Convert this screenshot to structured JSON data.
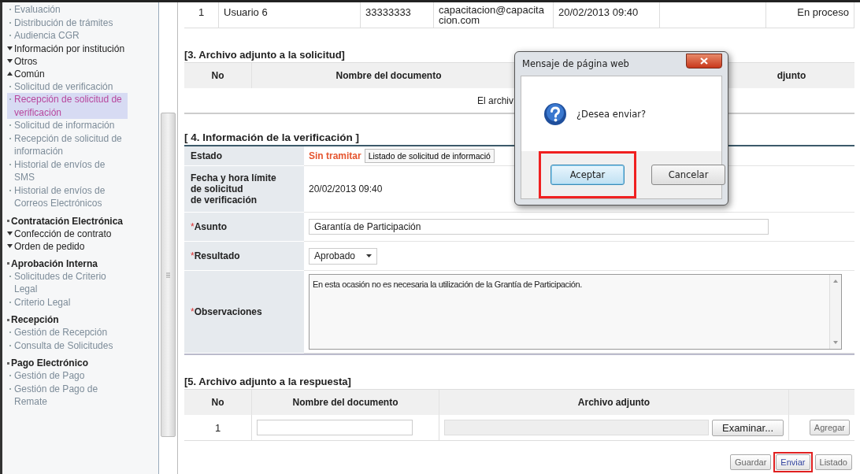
{
  "sidebar": {
    "items": [
      {
        "kind": "link",
        "label": "Evaluación",
        "selected": false
      },
      {
        "kind": "link",
        "label": "Distribución de trámites",
        "selected": false
      },
      {
        "kind": "link",
        "label": "Audiencia CGR",
        "selected": false
      },
      {
        "kind": "folder",
        "label": "Información por institución",
        "expanded": false
      },
      {
        "kind": "folder",
        "label": "Otros",
        "expanded": false
      },
      {
        "kind": "folder",
        "label": "Común",
        "expanded": true
      },
      {
        "kind": "link",
        "label": "Solicitud de verificación",
        "selected": false
      },
      {
        "kind": "link",
        "label": "Recepción de solicitud de verificación",
        "selected": true
      },
      {
        "kind": "link",
        "label": "Solicitud de información",
        "selected": false
      },
      {
        "kind": "link",
        "label": "Recepción de solicitud de información",
        "selected": false
      },
      {
        "kind": "link",
        "label": "Historial de envíos de SMS",
        "selected": false
      },
      {
        "kind": "link",
        "label": "Historial de envíos de Correos Electrónicos",
        "selected": false
      },
      {
        "kind": "header",
        "label": "Contratación Electrónica"
      },
      {
        "kind": "folder",
        "label": "Confección de contrato",
        "expanded": false
      },
      {
        "kind": "folder",
        "label": "Orden de pedido",
        "expanded": false
      },
      {
        "kind": "header",
        "label": "Aprobación Interna"
      },
      {
        "kind": "link",
        "label": "Solicitudes de Criterio Legal",
        "selected": false
      },
      {
        "kind": "link",
        "label": "Criterio Legal",
        "selected": false
      },
      {
        "kind": "header",
        "label": "Recepción"
      },
      {
        "kind": "link",
        "label": "Gestión de Recepción",
        "selected": false
      },
      {
        "kind": "link",
        "label": "Consulta de Solicitudes",
        "selected": false
      },
      {
        "kind": "header",
        "label": "Pago Electrónico"
      },
      {
        "kind": "link",
        "label": "Gestión de Pago",
        "selected": false
      },
      {
        "kind": "link",
        "label": "Gestión de Pago de Remate",
        "selected": false
      }
    ]
  },
  "top_table": {
    "rows": [
      {
        "no": "1",
        "name": "Usuario 6",
        "phone": "33333333",
        "email": "capacitacion@capacitacion.com",
        "date": "20/02/2013 09:40",
        "status": "En proceso"
      }
    ]
  },
  "section3": {
    "title": "[3. Archivo adjunto a la solicitud]",
    "columns": [
      "No",
      "Nombre del documento",
      "djunto"
    ],
    "message": "El archiv"
  },
  "section4": {
    "title": "[ 4. Información de la verificación ]",
    "estado": {
      "label": "Estado",
      "status": "Sin tramitar",
      "button": "Listado de solicitud de informació"
    },
    "fecha": {
      "label": "Fecha y hora límite\nde solicitud\nde verificación",
      "value": "20/02/2013 09:40"
    },
    "asunto": {
      "mark": "*",
      "label": "Asunto",
      "value": "Garantía de Participación"
    },
    "resultado": {
      "mark": "*",
      "label": "Resultado",
      "value": "Aprobado"
    },
    "observaciones": {
      "mark": "*",
      "label": "Observaciones",
      "value": "En esta ocasión no es necesaria la utilización de la Grantía de Participación."
    }
  },
  "section5": {
    "title": "[5. Archivo adjunto a la respuesta]",
    "columns": [
      "No",
      "Nombre del documento",
      "Archivo adjunto"
    ],
    "rows": [
      {
        "no": "1",
        "browse_button": "Examinar...",
        "add_button": "Agregar"
      }
    ]
  },
  "actions": [
    {
      "label": "Guardar",
      "highlighted": false
    },
    {
      "label": "Enviar",
      "highlighted": true
    },
    {
      "label": "Listado",
      "highlighted": false
    }
  ],
  "dialog": {
    "title": "Mensaje de página web",
    "message": "¿Desea enviar?",
    "buttons": [
      {
        "label": "Aceptar",
        "focused": true,
        "highlighted": true
      },
      {
        "label": "Cancelar",
        "focused": false,
        "highlighted": false
      }
    ]
  }
}
